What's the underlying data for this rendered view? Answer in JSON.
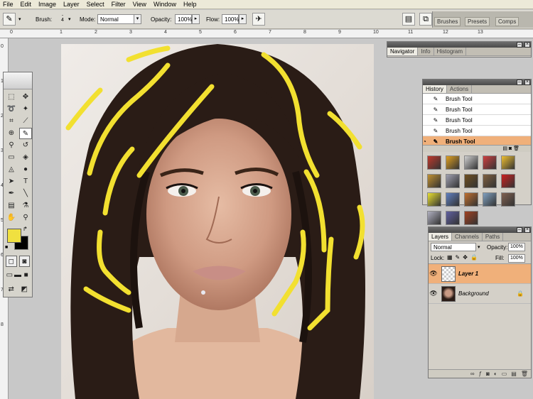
{
  "menu": [
    "File",
    "Edit",
    "Image",
    "Layer",
    "Select",
    "Filter",
    "View",
    "Window",
    "Help"
  ],
  "options": {
    "brush_label": "Brush:",
    "brush_size": "4",
    "mode_label": "Mode:",
    "mode_value": "Normal",
    "opacity_label": "Opacity:",
    "opacity_value": "100%",
    "flow_label": "Flow:",
    "flow_value": "100%"
  },
  "well_tabs": [
    "Brushes",
    "Presets",
    "Comps"
  ],
  "ruler_top": [
    "0",
    "1",
    "2",
    "3",
    "4",
    "5",
    "6",
    "7",
    "8",
    "9",
    "10",
    "11",
    "12",
    "13"
  ],
  "ruler_left": [
    "0",
    "1",
    "2",
    "3",
    "4",
    "5",
    "6",
    "7",
    "8"
  ],
  "navigator_panel": {
    "tabs": [
      "Navigator",
      "Info",
      "Histogram"
    ]
  },
  "history_panel": {
    "tabs": [
      "History",
      "Actions"
    ],
    "items": [
      "Brush Tool",
      "Brush Tool",
      "Brush Tool",
      "Brush Tool",
      "Brush Tool"
    ],
    "selected_index": 4
  },
  "styles_panel": {
    "swatches": [
      "#c0392b",
      "#e0a020",
      "#d0d0d0",
      "#d04040",
      "#f0c030",
      "#c09030",
      "#a0a0b0",
      "#705020",
      "#806040",
      "#cc2020",
      "#e8e030",
      "#6080c0",
      "#c07030",
      "#80a0c0",
      "#806050",
      "#b0b0c0",
      "#6060a0",
      "#a04020"
    ]
  },
  "layers_panel": {
    "tabs": [
      "Layers",
      "Channels",
      "Paths"
    ],
    "mode_value": "Normal",
    "opacity_label": "Opacity:",
    "opacity_value": "100%",
    "lock_label": "Lock:",
    "fill_label": "Fill:",
    "fill_value": "100%",
    "layers": [
      {
        "name": "Layer 1",
        "selected": true
      },
      {
        "name": "Background",
        "selected": false
      }
    ]
  },
  "colors": {
    "foreground": "#f0e040",
    "background": "#000000",
    "stroke": "#f2e030",
    "accent": "#f0b07a"
  }
}
